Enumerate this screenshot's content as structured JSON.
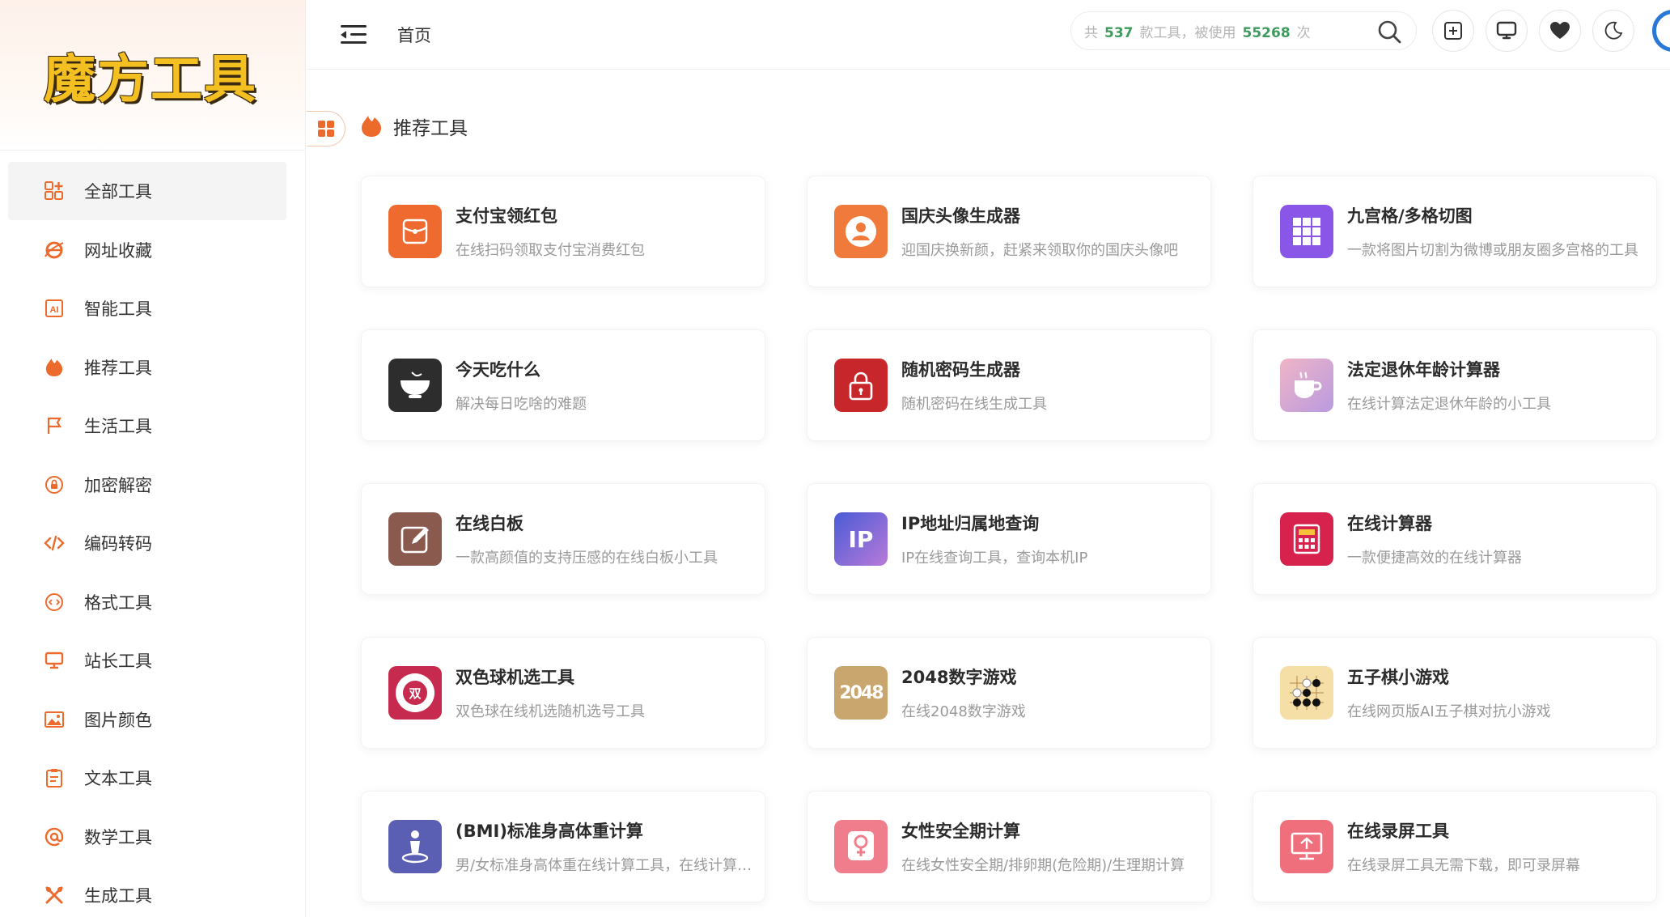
{
  "app": {
    "logo_text": "魔方工具"
  },
  "sidebar": {
    "items": [
      {
        "label": "全部工具",
        "icon": "grid-plus-icon",
        "active": true
      },
      {
        "label": "网址收藏",
        "icon": "browser-icon",
        "active": false
      },
      {
        "label": "智能工具",
        "icon": "ai-icon",
        "active": false
      },
      {
        "label": "推荐工具",
        "icon": "flame-icon",
        "active": false
      },
      {
        "label": "生活工具",
        "icon": "flag-icon",
        "active": false
      },
      {
        "label": "加密解密",
        "icon": "lock-circle-icon",
        "active": false
      },
      {
        "label": "编码转码",
        "icon": "code-icon",
        "active": false
      },
      {
        "label": "格式工具",
        "icon": "format-icon",
        "active": false
      },
      {
        "label": "站长工具",
        "icon": "monitor-icon",
        "active": false
      },
      {
        "label": "图片颜色",
        "icon": "image-icon",
        "active": false
      },
      {
        "label": "文本工具",
        "icon": "clipboard-icon",
        "active": false
      },
      {
        "label": "数学工具",
        "icon": "at-icon",
        "active": false
      },
      {
        "label": "生成工具",
        "icon": "tools-icon",
        "active": false
      }
    ]
  },
  "header": {
    "breadcrumb": "首页",
    "search": {
      "prefix": "共",
      "tool_count": "537",
      "middle": "款工具，被使用",
      "use_count": "55268",
      "suffix": "次"
    }
  },
  "section": {
    "title": "推荐工具"
  },
  "cards": [
    {
      "title": "支付宝领红包",
      "desc": "在线扫码领取支付宝消费红包",
      "icon": "red-packet-icon",
      "color": "#ee6a2e"
    },
    {
      "title": "国庆头像生成器",
      "desc": "迎国庆换新颜，赶紧来领取你的国庆头像吧",
      "icon": "avatar-icon",
      "color": "#f07a3c"
    },
    {
      "title": "九宫格/多格切图",
      "desc": "一款将图片切割为微博或朋友圈多宫格的工具",
      "icon": "nine-grid-icon",
      "color": "#8a56e8"
    },
    {
      "title": "今天吃什么",
      "desc": "解决每日吃啥的难题",
      "icon": "bowl-icon",
      "color": "#2d2d2d"
    },
    {
      "title": "随机密码生成器",
      "desc": "随机密码在线生成工具",
      "icon": "padlock-icon",
      "color": "#c7272a"
    },
    {
      "title": "法定退休年龄计算器",
      "desc": "在线计算法定退休年龄的小工具",
      "icon": "coffee-cup-icon",
      "color": "#d6a3d6"
    },
    {
      "title": "在线白板",
      "desc": "一款高颜值的支持压感的在线白板小工具",
      "icon": "whiteboard-icon",
      "color": "#8a5a4e"
    },
    {
      "title": "IP地址归属地查询",
      "desc": "IP在线查询工具，查询本机IP",
      "icon": "ip-icon",
      "color": "#5a63d8",
      "glyph": "IP"
    },
    {
      "title": "在线计算器",
      "desc": "一款便捷高效的在线计算器",
      "icon": "calculator-icon",
      "color": "#d8224e"
    },
    {
      "title": "双色球机选工具",
      "desc": "双色球在线机选随机选号工具",
      "icon": "lottery-icon",
      "color": "#c62a4e",
      "glyph": "双"
    },
    {
      "title": "2048数字游戏",
      "desc": "在线2048数字游戏",
      "icon": "game-2048-icon",
      "color": "#c9a66e",
      "glyph": "2048"
    },
    {
      "title": "五子棋小游戏",
      "desc": "在线网页版AI五子棋对抗小游戏",
      "icon": "gomoku-icon",
      "color": "#f2d99a"
    },
    {
      "title": "(BMI)标准身高体重计算",
      "desc": "男/女标准身高体重在线计算工具，在线计算BMI",
      "icon": "person-icon",
      "color": "#5a5fb4"
    },
    {
      "title": "女性安全期计算",
      "desc": "在线女性安全期/排卵期(危险期)/生理期计算",
      "icon": "female-icon",
      "color": "#ef7d8c"
    },
    {
      "title": "在线录屏工具",
      "desc": "在线录屏工具无需下载，即可录屏幕",
      "icon": "screen-record-icon",
      "color": "#ef6f7c"
    }
  ]
}
